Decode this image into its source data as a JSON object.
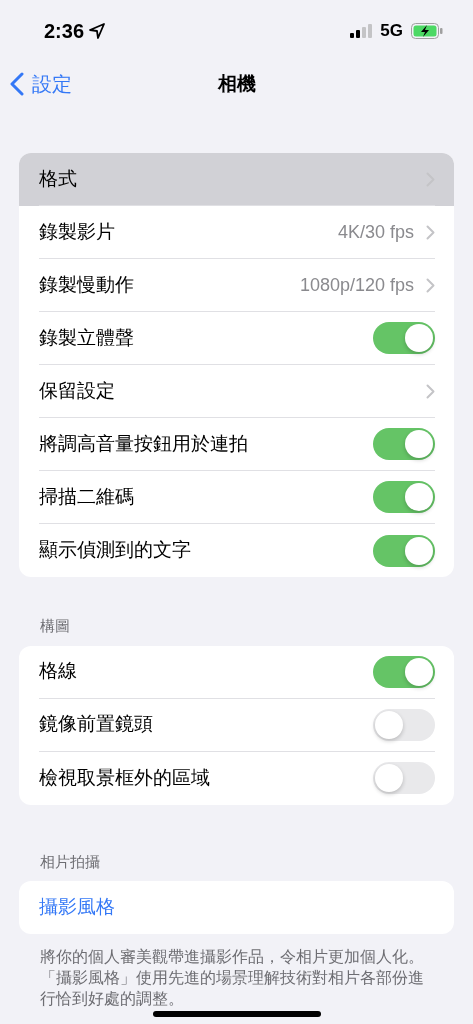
{
  "status_bar": {
    "time": "2:36",
    "network": "5G"
  },
  "nav": {
    "back": "設定",
    "title": "相機"
  },
  "groups": [
    {
      "rows": [
        {
          "kind": "link",
          "label": "格式",
          "highlighted": true
        },
        {
          "kind": "link",
          "label": "錄製影片",
          "value": "4K/30 fps",
          "highlighted": false
        },
        {
          "kind": "link",
          "label": "錄製慢動作",
          "value": "1080p/120 fps",
          "highlighted": false
        },
        {
          "kind": "toggle",
          "label": "錄製立體聲",
          "on": true
        },
        {
          "kind": "link",
          "label": "保留設定",
          "highlighted": false
        },
        {
          "kind": "toggle",
          "label": "將調高音量按鈕用於連拍",
          "on": true
        },
        {
          "kind": "toggle",
          "label": "掃描二維碼",
          "on": true
        },
        {
          "kind": "toggle",
          "label": "顯示偵測到的文字",
          "on": true
        }
      ]
    },
    {
      "header": "構圖",
      "rows": [
        {
          "kind": "toggle",
          "label": "格線",
          "on": true
        },
        {
          "kind": "toggle",
          "label": "鏡像前置鏡頭",
          "on": false
        },
        {
          "kind": "toggle",
          "label": "檢視取景框外的區域",
          "on": false
        }
      ]
    },
    {
      "header": "相片拍攝",
      "rows": [
        {
          "kind": "action",
          "label": "攝影風格"
        }
      ],
      "footer": "將你的個人審美觀帶進攝影作品，令相片更加個人化。「攝影風格」使用先進的場景理解技術對相片各部份進行恰到好處的調整。"
    }
  ]
}
